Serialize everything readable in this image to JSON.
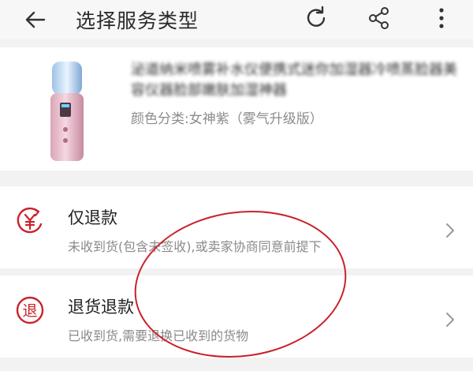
{
  "header": {
    "title": "选择服务类型",
    "icons": [
      "back-arrow-icon",
      "refresh-icon",
      "share-icon",
      "more-vertical-icon"
    ]
  },
  "product": {
    "title": "泌道纳米喷雾补水仪便携式迷你加湿器冷喷蒸脸器美容仪器脸部嫩肤加湿神器",
    "variant": "颜色分类:女神紫（雾气升级版）"
  },
  "options": [
    {
      "title": "仅退款",
      "description": "未收到货(包含未签收),或卖家协商同意前提下",
      "icon": "refund-yen-icon"
    },
    {
      "title": "退货退款",
      "description": "已收到货,需要退换已收到的货物",
      "icon": "return-badge-icon",
      "icon_text": "退"
    }
  ],
  "colors": {
    "accent": "#c9222a",
    "annotation": "#c9222a"
  }
}
